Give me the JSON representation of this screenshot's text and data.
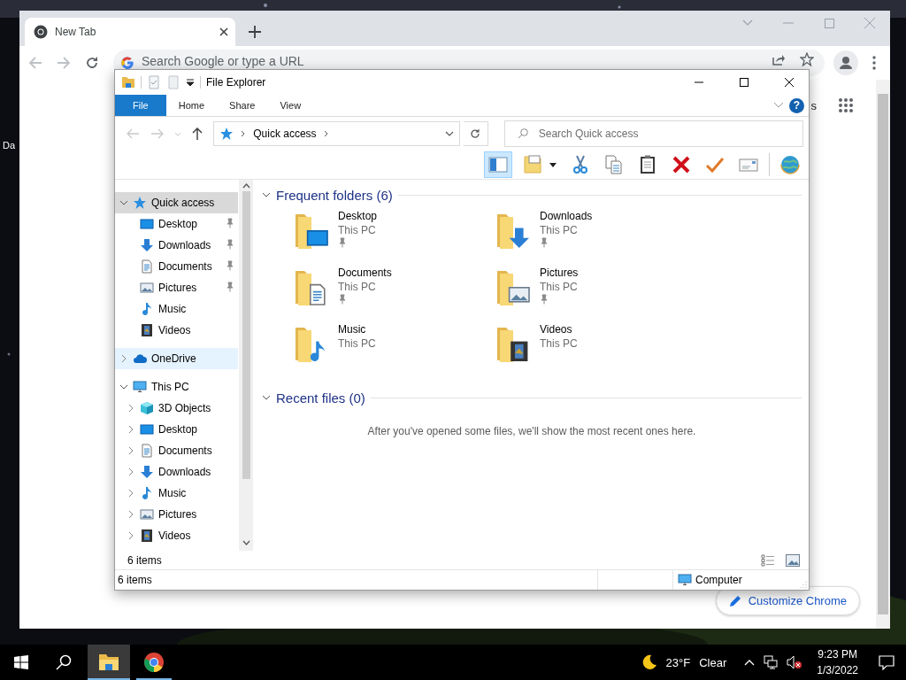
{
  "desktop": {
    "icon_label": "Da"
  },
  "browser": {
    "tabs": [
      {
        "title": "New Tab",
        "selected": true
      }
    ],
    "omnibox": {
      "placeholder": "Search Google or type a URL"
    },
    "page_link": "s",
    "customize_button": "Customize Chrome"
  },
  "explorer": {
    "title": "File Explorer",
    "ribbon_tabs": [
      {
        "label": "File",
        "selected": true
      },
      {
        "label": "Home",
        "selected": false
      },
      {
        "label": "Share",
        "selected": false
      },
      {
        "label": "View",
        "selected": false
      }
    ],
    "help_button": "?",
    "address": {
      "location": "Quick access"
    },
    "search": {
      "placeholder": "Search Quick access"
    },
    "toolbar": [
      {
        "kind": "preview_pane",
        "selected": true
      },
      {
        "kind": "new_folder",
        "selected": false
      },
      {
        "kind": "cut",
        "selected": false
      },
      {
        "kind": "copy",
        "selected": false
      },
      {
        "kind": "paste",
        "selected": false
      },
      {
        "kind": "delete",
        "selected": false
      },
      {
        "kind": "check",
        "selected": false
      },
      {
        "kind": "email",
        "selected": false
      },
      {
        "kind": "globe",
        "selected": false
      }
    ],
    "nav": [
      {
        "label": "Quick access",
        "kind": "quick",
        "expanded": true,
        "selected": true,
        "hovered": false,
        "children": [
          {
            "label": "Desktop",
            "kind": "desktop",
            "pinned": true,
            "selected": false
          },
          {
            "label": "Downloads",
            "kind": "downloads",
            "pinned": true,
            "selected": false
          },
          {
            "label": "Documents",
            "kind": "documents",
            "pinned": true,
            "selected": false
          },
          {
            "label": "Pictures",
            "kind": "pictures",
            "pinned": true,
            "selected": false
          },
          {
            "label": "Music",
            "kind": "music",
            "pinned": false,
            "selected": false
          },
          {
            "label": "Videos",
            "kind": "videos",
            "pinned": false,
            "selected": false
          }
        ]
      },
      {
        "label": "OneDrive",
        "kind": "onedrive",
        "expanded": false,
        "selected": false,
        "hovered": true
      },
      {
        "label": "This PC",
        "kind": "thispc",
        "expanded": true,
        "selected": false,
        "hovered": false,
        "children": [
          {
            "label": "3D Objects",
            "kind": "objects3d",
            "expanded": false,
            "selected": false
          },
          {
            "label": "Desktop",
            "kind": "desktop",
            "expanded": false,
            "selected": false
          },
          {
            "label": "Documents",
            "kind": "documents",
            "expanded": false,
            "selected": false
          },
          {
            "label": "Downloads",
            "kind": "downloads",
            "expanded": false,
            "selected": false
          },
          {
            "label": "Music",
            "kind": "music",
            "expanded": false,
            "selected": false
          },
          {
            "label": "Pictures",
            "kind": "pictures",
            "expanded": false,
            "selected": false
          },
          {
            "label": "Videos",
            "kind": "videos",
            "expanded": false,
            "selected": false
          }
        ]
      }
    ],
    "pane_count": "6 items",
    "frequent": {
      "title": "Frequent folders (6)",
      "expanded": true,
      "folders": [
        {
          "name": "Desktop",
          "location": "This PC",
          "kind": "desktop",
          "pinned": true
        },
        {
          "name": "Downloads",
          "location": "This PC",
          "kind": "downloads",
          "pinned": true
        },
        {
          "name": "Documents",
          "location": "This PC",
          "kind": "documents",
          "pinned": true
        },
        {
          "name": "Pictures",
          "location": "This PC",
          "kind": "pictures",
          "pinned": true
        },
        {
          "name": "Music",
          "location": "This PC",
          "kind": "music",
          "pinned": false
        },
        {
          "name": "Videos",
          "location": "This PC",
          "kind": "videos",
          "pinned": false
        }
      ]
    },
    "recent": {
      "title": "Recent files (0)",
      "expanded": true,
      "message": "After you've opened some files, we'll show the most recent ones here."
    },
    "status_bar": {
      "count": "6 items",
      "location": "Computer"
    }
  },
  "taskbar": {
    "apps": [
      {
        "kind": "file_explorer",
        "active": true
      },
      {
        "kind": "browser",
        "active": false
      }
    ],
    "weather": {
      "temperature": "23°F",
      "condition": "Clear"
    },
    "time": "9:23 PM",
    "date": "1/3/2022"
  }
}
